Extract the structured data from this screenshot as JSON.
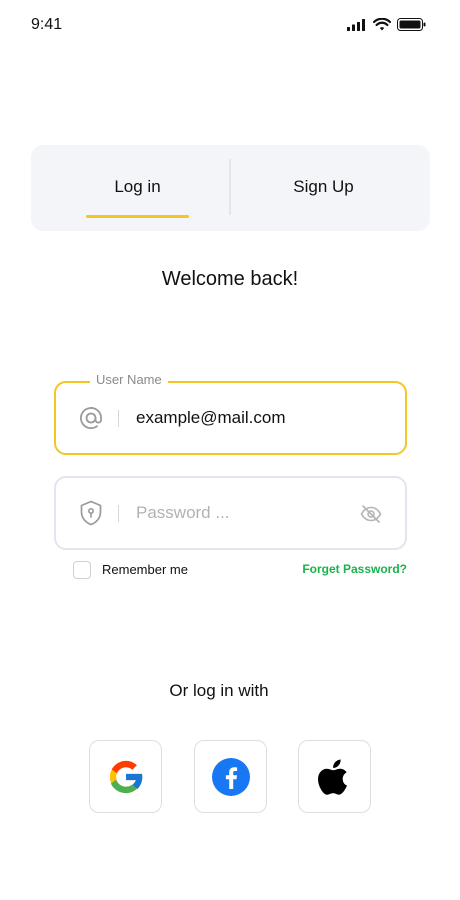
{
  "status_bar": {
    "time": "9:41",
    "icons": [
      "signal-icon",
      "wifi-icon",
      "battery-icon"
    ]
  },
  "tabs": {
    "items": [
      {
        "label": "Log in",
        "active": true
      },
      {
        "label": "Sign Up",
        "active": false
      }
    ]
  },
  "welcome": "Welcome back!",
  "username_field": {
    "legend": "User Name",
    "value": "example@mail.com",
    "icon": "at-icon"
  },
  "password_field": {
    "placeholder": "Password ...",
    "value": "",
    "icon": "shield-lock-icon",
    "toggle_icon": "eye-off-icon"
  },
  "remember": {
    "label": "Remember me",
    "checked": false
  },
  "forgot_password": "Forget Password?",
  "or_text": "Or log in with",
  "social": [
    {
      "name": "google",
      "icon": "google-icon"
    },
    {
      "name": "facebook",
      "icon": "facebook-icon"
    },
    {
      "name": "apple",
      "icon": "apple-icon"
    }
  ],
  "colors": {
    "accent": "#f3c623",
    "link": "#19b34a",
    "tabs_background": "#f4f5f9",
    "facebook": "#1877f2"
  }
}
